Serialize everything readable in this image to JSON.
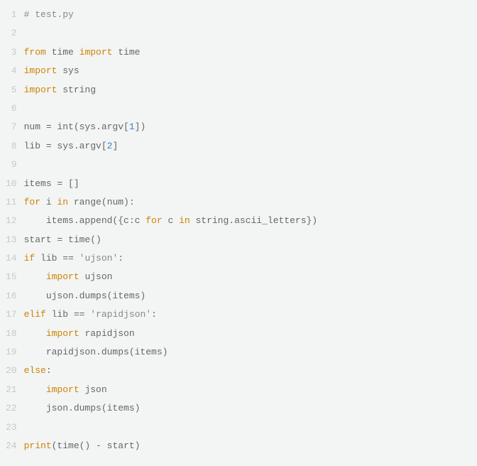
{
  "code": {
    "lines": [
      {
        "num": "1",
        "tokens": [
          {
            "t": "comment",
            "v": "# test.py"
          }
        ]
      },
      {
        "num": "2",
        "tokens": []
      },
      {
        "num": "3",
        "tokens": [
          {
            "t": "keyword",
            "v": "from"
          },
          {
            "t": "text",
            "v": " time "
          },
          {
            "t": "keyword",
            "v": "import"
          },
          {
            "t": "text",
            "v": " time"
          }
        ]
      },
      {
        "num": "4",
        "tokens": [
          {
            "t": "keyword",
            "v": "import"
          },
          {
            "t": "text",
            "v": " sys"
          }
        ]
      },
      {
        "num": "5",
        "tokens": [
          {
            "t": "keyword",
            "v": "import"
          },
          {
            "t": "text",
            "v": " string"
          }
        ]
      },
      {
        "num": "6",
        "tokens": []
      },
      {
        "num": "7",
        "tokens": [
          {
            "t": "text",
            "v": "num = int(sys.argv["
          },
          {
            "t": "number",
            "v": "1"
          },
          {
            "t": "text",
            "v": "])"
          }
        ]
      },
      {
        "num": "8",
        "tokens": [
          {
            "t": "text",
            "v": "lib = sys.argv["
          },
          {
            "t": "number",
            "v": "2"
          },
          {
            "t": "text",
            "v": "]"
          }
        ]
      },
      {
        "num": "9",
        "tokens": []
      },
      {
        "num": "10",
        "tokens": [
          {
            "t": "text",
            "v": "items = []"
          }
        ]
      },
      {
        "num": "11",
        "tokens": [
          {
            "t": "keyword",
            "v": "for"
          },
          {
            "t": "text",
            "v": " i "
          },
          {
            "t": "keyword",
            "v": "in"
          },
          {
            "t": "text",
            "v": " range(num):"
          }
        ]
      },
      {
        "num": "12",
        "tokens": [
          {
            "t": "text",
            "v": "    items.append({c:c "
          },
          {
            "t": "keyword",
            "v": "for"
          },
          {
            "t": "text",
            "v": " c "
          },
          {
            "t": "keyword",
            "v": "in"
          },
          {
            "t": "text",
            "v": " string.ascii_letters})"
          }
        ]
      },
      {
        "num": "13",
        "tokens": [
          {
            "t": "text",
            "v": "start = time()"
          }
        ]
      },
      {
        "num": "14",
        "tokens": [
          {
            "t": "keyword",
            "v": "if"
          },
          {
            "t": "text",
            "v": " lib == "
          },
          {
            "t": "string",
            "v": "'ujson'"
          },
          {
            "t": "text",
            "v": ":"
          }
        ]
      },
      {
        "num": "15",
        "tokens": [
          {
            "t": "text",
            "v": "    "
          },
          {
            "t": "keyword",
            "v": "import"
          },
          {
            "t": "text",
            "v": " ujson"
          }
        ]
      },
      {
        "num": "16",
        "tokens": [
          {
            "t": "text",
            "v": "    ujson.dumps(items)"
          }
        ]
      },
      {
        "num": "17",
        "tokens": [
          {
            "t": "keyword",
            "v": "elif"
          },
          {
            "t": "text",
            "v": " lib == "
          },
          {
            "t": "string",
            "v": "'rapidjson'"
          },
          {
            "t": "text",
            "v": ":"
          }
        ]
      },
      {
        "num": "18",
        "tokens": [
          {
            "t": "text",
            "v": "    "
          },
          {
            "t": "keyword",
            "v": "import"
          },
          {
            "t": "text",
            "v": " rapidjson"
          }
        ]
      },
      {
        "num": "19",
        "tokens": [
          {
            "t": "text",
            "v": "    rapidjson.dumps(items)"
          }
        ]
      },
      {
        "num": "20",
        "tokens": [
          {
            "t": "keyword",
            "v": "else"
          },
          {
            "t": "text",
            "v": ":"
          }
        ]
      },
      {
        "num": "21",
        "tokens": [
          {
            "t": "text",
            "v": "    "
          },
          {
            "t": "keyword",
            "v": "import"
          },
          {
            "t": "text",
            "v": " json"
          }
        ]
      },
      {
        "num": "22",
        "tokens": [
          {
            "t": "text",
            "v": "    json.dumps(items)"
          }
        ]
      },
      {
        "num": "23",
        "tokens": []
      },
      {
        "num": "24",
        "tokens": [
          {
            "t": "keyword",
            "v": "print"
          },
          {
            "t": "text",
            "v": "(time() - start)"
          }
        ]
      }
    ]
  }
}
